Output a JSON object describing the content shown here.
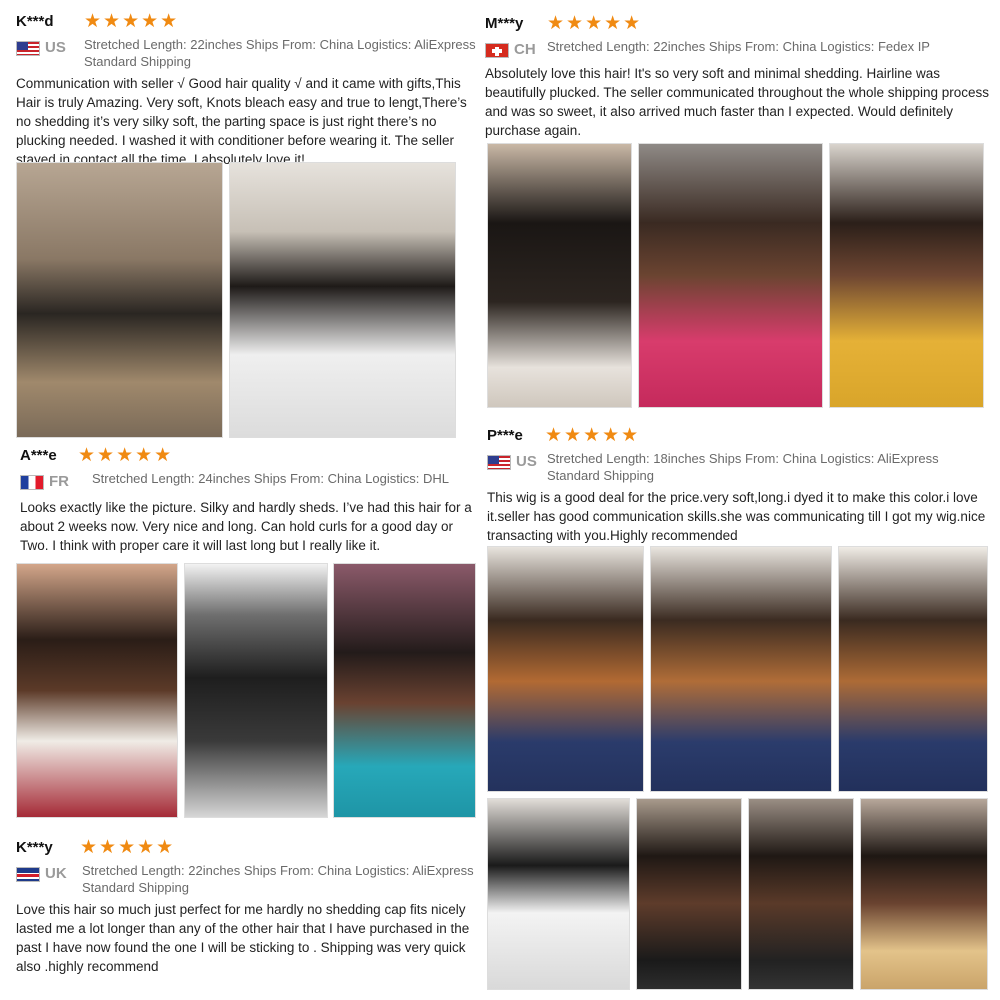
{
  "reviews": [
    {
      "reviewer": "K***d",
      "stars": "★★★★★",
      "country": "US",
      "flag_icon": "us-flag-icon",
      "meta_line1": "Stretched Length: 22inches Ships From: China Logistics: AliExpress",
      "meta_line2": "Standard Shipping",
      "text": "Communication with seller √ Good hair quality √ and it came with gifts,This Hair is truly Amazing. Very soft, Knots bleach easy and true to lengt,There’s no shedding it’s very silky soft, the parting space is just right there’s no plucking needed. I washed it with conditioner before wearing it. The seller stayed in contact all the time, I absolutely love it!"
    },
    {
      "reviewer": "M***y",
      "stars": "★★★★★",
      "country": "CH",
      "flag_icon": "switzerland-flag-icon",
      "meta_line1": "Stretched Length: 22inches Ships From: China Logistics: Fedex IP",
      "meta_line2": "",
      "text": "Absolutely love this hair! It's so very soft and minimal shedding. Hairline was beautifully plucked. The seller communicated throughout the whole shipping process and was so sweet, it also arrived much faster than I expected. Would definitely purchase again."
    },
    {
      "reviewer": "A***e",
      "stars": "★★★★★",
      "country": "FR",
      "flag_icon": "france-flag-icon",
      "meta_line1": "Stretched Length: 24inches Ships From: China Logistics: DHL",
      "meta_line2": "",
      "text": "Looks exactly like the picture. Silky and hardly sheds. I’ve had this hair for a about 2 weeks now. Very nice and long. Can hold curls for a good day or Two. I think with proper care it will last long but I really like it."
    },
    {
      "reviewer": "P***e",
      "stars": "★★★★★",
      "country": "US",
      "flag_icon": "us-flag-icon",
      "meta_line1": "Stretched Length: 18inches Ships From: China Logistics: AliExpress",
      "meta_line2": "Standard Shipping",
      "text": "This wig is a good deal for the price.very soft,long.i dyed it to make this color.i love it.seller has good communication skills.she was communicating till I got my wig.nice transacting with you.Highly recommended"
    },
    {
      "reviewer": "K***y",
      "stars": "★★★★★",
      "country": "UK",
      "flag_icon": "uk-flag-icon",
      "meta_line1": "Stretched Length: 22inches Ships From: China Logistics: AliExpress",
      "meta_line2": "Standard Shipping",
      "text": "Love this hair so much just perfect for me hardly no shedding cap fits nicely lasted me a lot longer than any of the other hair that I have purchased in the past I have now found the one I will be sticking to . Shipping was very quick also .highly recommend"
    }
  ],
  "colors": {
    "star": "#f08a12",
    "meta_text": "#6a6a6a",
    "country_code": "#9a9a9a"
  }
}
